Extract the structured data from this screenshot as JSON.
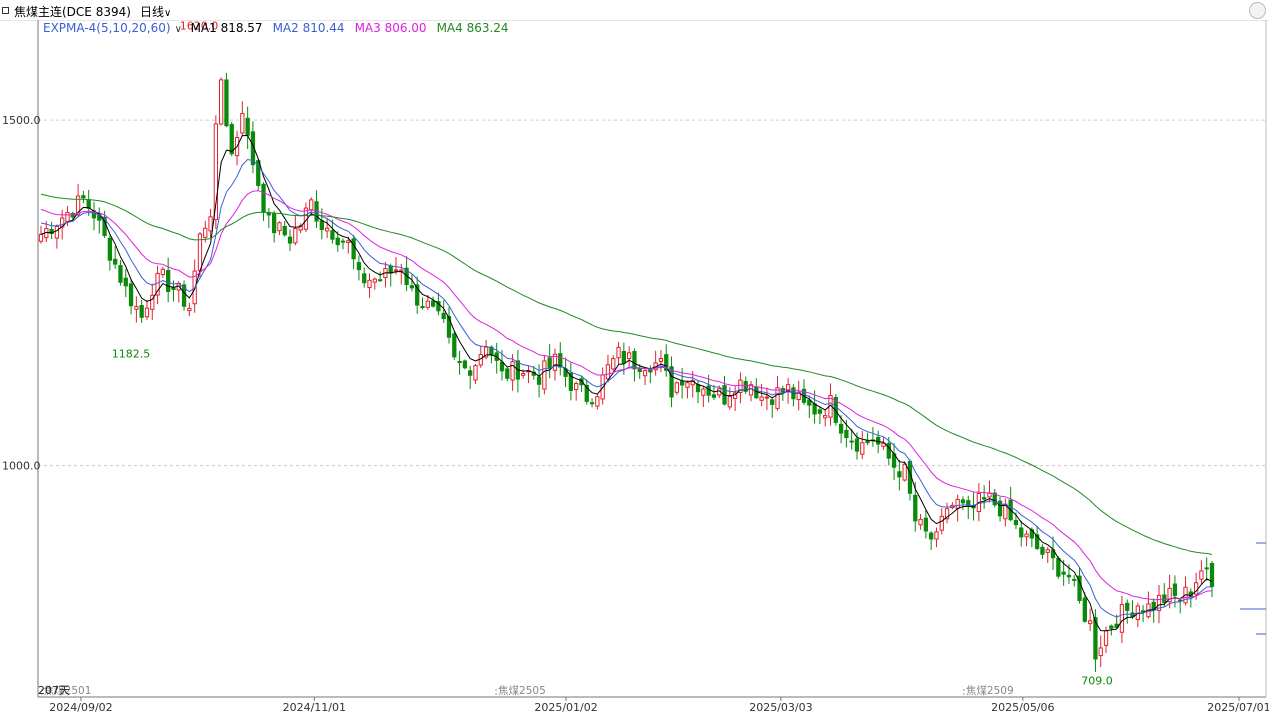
{
  "toolbar": {
    "instrument": "焦煤主连(DCE 8394)",
    "period": "日线",
    "chevron_icon": "chevron-down-icon"
  },
  "indicator": {
    "name": "EXPMA-4(5,10,20,60)",
    "chevron_icon": "chevron-down-icon",
    "ma": [
      {
        "label": "MA1 818.57",
        "color": "#000000"
      },
      {
        "label": "MA2 810.44",
        "color": "#3a5fd6"
      },
      {
        "label": "MA3 806.00",
        "color": "#e020e0"
      },
      {
        "label": "MA4 863.24",
        "color": "#1f8a1f"
      }
    ]
  },
  "colors": {
    "up": "#e0232e",
    "down": "#0a8a0a",
    "grid": "#cccccc",
    "axis": "#777777"
  },
  "chart_data": {
    "type": "candlestick",
    "ylim": [
      665,
      1645
    ],
    "y_ticks": [
      {
        "value": 1500,
        "label": "1500.0"
      },
      {
        "value": 1000,
        "label": "1000.0"
      }
    ],
    "x_ticks": [
      {
        "pos": 0.035,
        "label": "2024/09/02"
      },
      {
        "pos": 0.225,
        "label": "2024/11/01"
      },
      {
        "pos": 0.43,
        "label": "2025/01/02"
      },
      {
        "pos": 0.605,
        "label": "2025/03/03"
      },
      {
        "pos": 0.802,
        "label": "2025/05/06"
      },
      {
        "pos": 0.978,
        "label": "2025/07/01"
      }
    ],
    "contract_marks": [
      {
        "pos": 0.003,
        "label": "焦煤2501"
      },
      {
        "pos": 0.373,
        "label": "焦煤2505"
      },
      {
        "pos": 0.754,
        "label": "焦煤2509"
      }
    ],
    "bars_label": "207天",
    "annotations": [
      {
        "value": 1620.0,
        "label": "1620.0",
        "kind": "high"
      },
      {
        "value": 1182.5,
        "label": "1182.5",
        "kind": "low"
      },
      {
        "value": 709.0,
        "label": "709.0",
        "kind": "low"
      }
    ],
    "anchors": [
      [
        0,
        1335
      ],
      [
        4,
        1360
      ],
      [
        8,
        1385
      ],
      [
        10,
        1365
      ],
      [
        13,
        1310
      ],
      [
        16,
        1255
      ],
      [
        19,
        1215
      ],
      [
        21,
        1260
      ],
      [
        23,
        1270
      ],
      [
        26,
        1250
      ],
      [
        28,
        1230
      ],
      [
        30,
        1330
      ],
      [
        32,
        1370
      ],
      [
        33,
        1480
      ],
      [
        34,
        1560
      ],
      [
        35,
        1500
      ],
      [
        36,
        1450
      ],
      [
        37,
        1480
      ],
      [
        38,
        1520
      ],
      [
        39,
        1470
      ],
      [
        40,
        1440
      ],
      [
        42,
        1380
      ],
      [
        43,
        1350
      ],
      [
        45,
        1340
      ],
      [
        47,
        1330
      ],
      [
        49,
        1350
      ],
      [
        51,
        1380
      ],
      [
        53,
        1350
      ],
      [
        55,
        1340
      ],
      [
        58,
        1320
      ],
      [
        60,
        1270
      ],
      [
        64,
        1270
      ],
      [
        68,
        1290
      ],
      [
        70,
        1250
      ],
      [
        73,
        1230
      ],
      [
        76,
        1200
      ],
      [
        78,
        1150
      ],
      [
        80,
        1140
      ],
      [
        82,
        1150
      ],
      [
        84,
        1180
      ],
      [
        87,
        1130
      ],
      [
        90,
        1140
      ],
      [
        94,
        1130
      ],
      [
        97,
        1150
      ],
      [
        99,
        1130
      ],
      [
        101,
        1110
      ],
      [
        103,
        1100
      ],
      [
        105,
        1110
      ],
      [
        107,
        1140
      ],
      [
        109,
        1160
      ],
      [
        112,
        1150
      ],
      [
        115,
        1150
      ],
      [
        117,
        1145
      ],
      [
        119,
        1110
      ],
      [
        121,
        1130
      ],
      [
        124,
        1120
      ],
      [
        127,
        1105
      ],
      [
        129,
        1100
      ],
      [
        131,
        1120
      ],
      [
        134,
        1120
      ],
      [
        136,
        1100
      ],
      [
        139,
        1105
      ],
      [
        141,
        1110
      ],
      [
        144,
        1085
      ],
      [
        147,
        1080
      ],
      [
        149,
        1090
      ],
      [
        151,
        1060
      ],
      [
        153,
        1040
      ],
      [
        155,
        1030
      ],
      [
        157,
        1040
      ],
      [
        159,
        1020
      ],
      [
        161,
        1000
      ],
      [
        163,
        990
      ],
      [
        165,
        920
      ],
      [
        167,
        900
      ],
      [
        169,
        890
      ],
      [
        171,
        940
      ],
      [
        173,
        945
      ],
      [
        175,
        930
      ],
      [
        177,
        945
      ],
      [
        179,
        950
      ],
      [
        181,
        940
      ],
      [
        183,
        920
      ],
      [
        185,
        900
      ],
      [
        188,
        880
      ],
      [
        191,
        860
      ],
      [
        194,
        840
      ],
      [
        196,
        800
      ],
      [
        198,
        770
      ],
      [
        199,
        730
      ],
      [
        200,
        745
      ],
      [
        201,
        760
      ],
      [
        203,
        780
      ],
      [
        205,
        790
      ],
      [
        207,
        800
      ],
      [
        209,
        795
      ],
      [
        211,
        805
      ],
      [
        213,
        810
      ],
      [
        215,
        808
      ],
      [
        217,
        820
      ],
      [
        219,
        850
      ],
      [
        220,
        840
      ],
      [
        221,
        825
      ]
    ],
    "expma_periods": [
      5,
      10,
      20,
      60
    ]
  }
}
